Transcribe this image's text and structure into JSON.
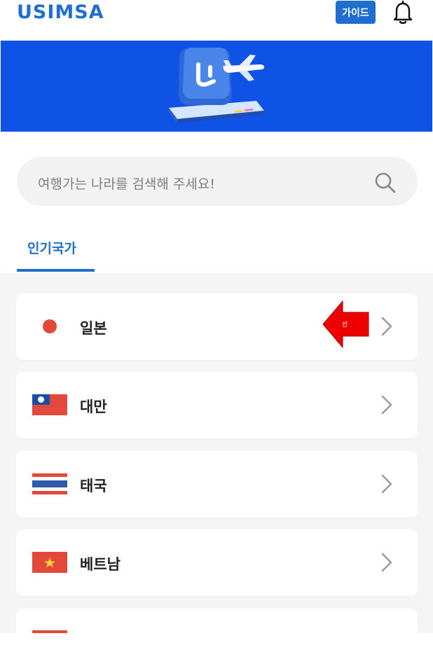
{
  "header": {
    "logo": "USIMSA",
    "guide_label": "가이드"
  },
  "search": {
    "placeholder": "여행가는 나라를 검색해 주세요!"
  },
  "tabs": [
    {
      "label": "인기국가"
    }
  ],
  "countries": [
    {
      "name": "일본",
      "flag": "japan-flag"
    },
    {
      "name": "대만",
      "flag": "taiwan-flag"
    },
    {
      "name": "태국",
      "flag": "thailand-flag"
    },
    {
      "name": "베트남",
      "flag": "vietnam-flag"
    }
  ],
  "annotation": {
    "callout_text": "선"
  },
  "colors": {
    "brand": "#1f6fd1",
    "banner": "#0f52e6",
    "callout": "#ee0000"
  }
}
